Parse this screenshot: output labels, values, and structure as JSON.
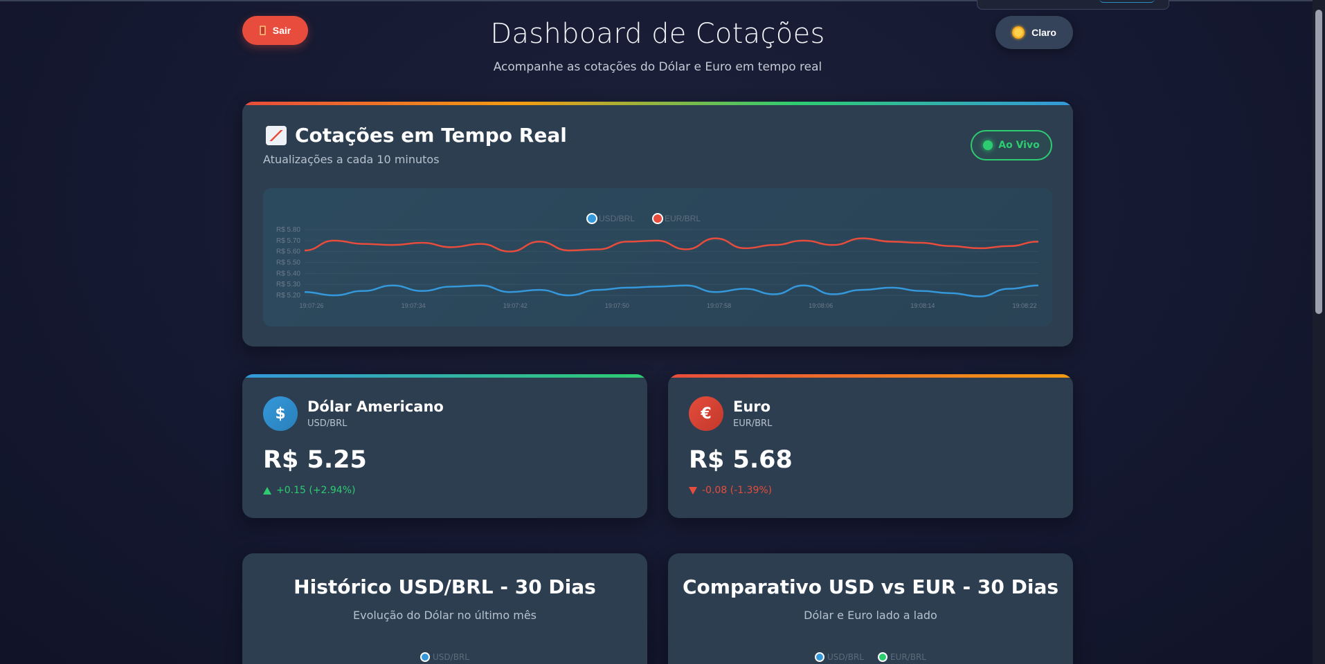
{
  "header": {
    "logout_label": "Sair",
    "theme_label": "Claro",
    "title": "Dashboard de Cotações",
    "subtitle": "Acompanhe as cotações do Dólar e Euro em tempo real"
  },
  "realtime": {
    "title": "Cotações em Tempo Real",
    "subtitle": "Atualizações a cada 10 minutos",
    "live_label": "Ao Vivo"
  },
  "colors": {
    "usd": "#3498db",
    "eur": "#e74c3c",
    "eur_alt": "#2ecc71",
    "live": "#2ecc71",
    "card": "#2c3e50"
  },
  "chart_data": {
    "type": "line",
    "legend_position": "top-center",
    "y_ticks": [
      "R$ 5.80",
      "R$ 5.70",
      "R$ 5.60",
      "R$ 5.50",
      "R$ 5.40",
      "R$ 5.30",
      "R$ 5.20"
    ],
    "ylim": [
      5.2,
      5.8
    ],
    "x_ticks": [
      "19:07:26",
      "19:07:34",
      "19:07:42",
      "19:07:50",
      "19:07:58",
      "19:08:06",
      "19:08:14",
      "19:08:22"
    ],
    "grid": true,
    "series": [
      {
        "name": "USD/BRL",
        "values": [
          5.23,
          5.2,
          5.24,
          5.29,
          5.24,
          5.28,
          5.29,
          5.23,
          5.25,
          5.2,
          5.25,
          5.27,
          5.28,
          5.29,
          5.23,
          5.26,
          5.21,
          5.29,
          5.21,
          5.25,
          5.27,
          5.24,
          5.22,
          5.19,
          5.26,
          5.29
        ]
      },
      {
        "name": "EUR/BRL",
        "values": [
          5.61,
          5.7,
          5.67,
          5.66,
          5.68,
          5.64,
          5.67,
          5.6,
          5.69,
          5.61,
          5.62,
          5.69,
          5.7,
          5.62,
          5.72,
          5.63,
          5.66,
          5.7,
          5.66,
          5.72,
          5.69,
          5.68,
          5.65,
          5.63,
          5.65,
          5.69
        ]
      }
    ]
  },
  "usd": {
    "icon": "dollar-icon",
    "symbol": "$",
    "name": "Dólar Americano",
    "pair": "USD/BRL",
    "value": "R$ 5.25",
    "change": "+0.15 (+2.94%)",
    "direction": "up"
  },
  "eur": {
    "icon": "euro-icon",
    "symbol": "€",
    "name": "Euro",
    "pair": "EUR/BRL",
    "value": "R$ 5.68",
    "change": "-0.08 (-1.39%)",
    "direction": "down"
  },
  "history": {
    "title": "Histórico USD/BRL - 30 Dias",
    "subtitle": "Evolução do Dólar no último mês",
    "legend": [
      "USD/BRL"
    ]
  },
  "comparison": {
    "title": "Comparativo USD vs EUR - 30 Dias",
    "subtitle": "Dólar e Euro lado a lado",
    "legend": [
      "USD/BRL",
      "EUR/BRL"
    ]
  }
}
